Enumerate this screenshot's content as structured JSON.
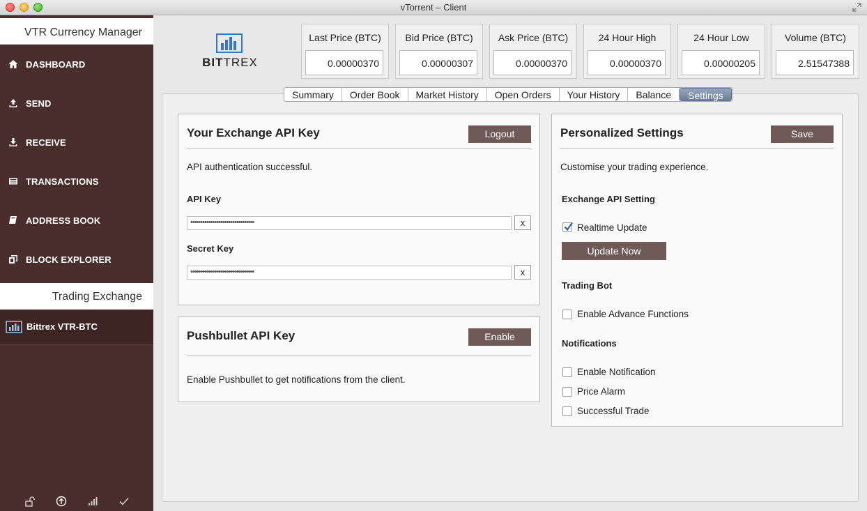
{
  "window": {
    "title": "vTorrent – Client"
  },
  "sidebar": {
    "header": "VTR Currency Manager",
    "items": [
      {
        "label": "DASHBOARD",
        "icon": "home-icon"
      },
      {
        "label": "SEND",
        "icon": "upload-icon"
      },
      {
        "label": "RECEIVE",
        "icon": "download-icon"
      },
      {
        "label": "TRANSACTIONS",
        "icon": "list-icon"
      },
      {
        "label": "ADDRESS BOOK",
        "icon": "book-icon"
      },
      {
        "label": "BLOCK EXPLORER",
        "icon": "explorer-icon"
      }
    ],
    "section2_header": "Trading Exchange",
    "exchange_item": {
      "label": "Bittrex VTR-BTC",
      "icon": "bar-chart-icon"
    },
    "footer_icons": [
      "unlock-icon",
      "arrow-up-circle-icon",
      "signal-icon",
      "check-icon"
    ]
  },
  "header": {
    "logo": {
      "text_bold": "BIT",
      "text_thin": "TREX"
    },
    "stats": [
      {
        "label": "Last Price (BTC)",
        "value": "0.00000370"
      },
      {
        "label": "Bid Price (BTC)",
        "value": "0.00000307"
      },
      {
        "label": "Ask Price (BTC)",
        "value": "0.00000370"
      },
      {
        "label": "24 Hour High",
        "value": "0.00000370"
      },
      {
        "label": "24 Hour Low",
        "value": "0.00000205"
      },
      {
        "label": "Volume (BTC)",
        "value": "2.51547388"
      }
    ]
  },
  "tabs": [
    "Summary",
    "Order Book",
    "Market History",
    "Open Orders",
    "Your History",
    "Balance",
    "Settings"
  ],
  "active_tab": "Settings",
  "api_box": {
    "title": "Your Exchange API Key",
    "logout_label": "Logout",
    "status": "API authentication successful.",
    "api_key_label": "API Key",
    "api_key_value": "••••••••••••••••••••••••••••••••",
    "secret_key_label": "Secret Key",
    "secret_key_value": "••••••••••••••••••••••••••••••••",
    "clear_label": "x"
  },
  "pushbullet_box": {
    "title": "Pushbullet API Key",
    "enable_label": "Enable",
    "description": "Enable Pushbullet to get notifications from the client."
  },
  "settings_box": {
    "title": "Personalized Settings",
    "save_label": "Save",
    "description": "Customise your trading experience.",
    "exchange_section": "Exchange API Setting",
    "realtime_label": "Realtime Update",
    "realtime_checked": true,
    "update_now_label": "Update Now",
    "bot_section": "Trading Bot",
    "advance_label": "Enable Advance Functions",
    "advance_checked": false,
    "notif_section": "Notifications",
    "enable_notif_label": "Enable Notification",
    "price_alarm_label": "Price Alarm",
    "successful_trade_label": "Successful Trade"
  }
}
